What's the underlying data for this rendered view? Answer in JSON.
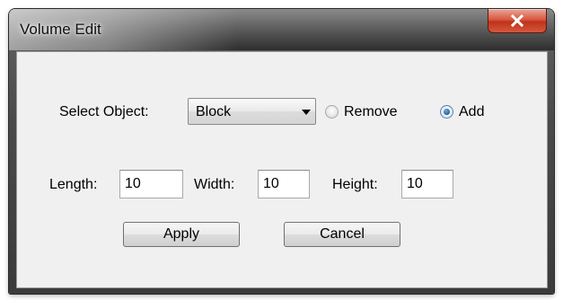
{
  "window": {
    "title": "Volume Edit",
    "close_icon": "close-icon",
    "close_color": "#c7402a"
  },
  "object_selection": {
    "label": "Select Object:",
    "selected_value": "Block"
  },
  "mode": {
    "remove_label": "Remove",
    "remove_checked": false,
    "add_label": "Add",
    "add_checked": true
  },
  "dimensions": {
    "length_label": "Length:",
    "length_value": "10",
    "width_label": "Width:",
    "width_value": "10",
    "height_label": "Height:",
    "height_value": "10"
  },
  "actions": {
    "apply_label": "Apply",
    "cancel_label": "Cancel"
  }
}
